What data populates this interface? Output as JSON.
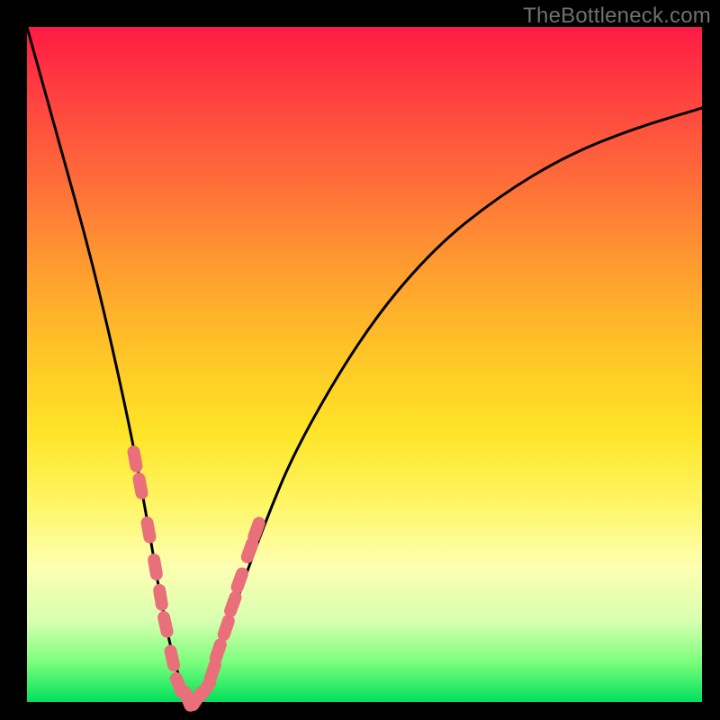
{
  "watermark": "TheBottleneck.com",
  "colors": {
    "gradient_top": "#ff1a44",
    "gradient_bottom": "#00e05a",
    "curve": "#000000",
    "markers": "#e96f7b",
    "frame": "#000000"
  },
  "chart_data": {
    "type": "line",
    "title": "",
    "xlabel": "",
    "ylabel": "",
    "xlim": [
      0,
      100
    ],
    "ylim": [
      0,
      100
    ],
    "series": [
      {
        "name": "bottleneck-curve",
        "description": "V-shaped bottleneck percentage curve",
        "x": [
          0,
          5,
          10,
          15,
          18,
          20,
          22,
          24,
          25,
          27,
          30,
          35,
          40,
          50,
          60,
          70,
          80,
          90,
          100
        ],
        "y": [
          100,
          82,
          64,
          42,
          26,
          14,
          5,
          0,
          0,
          3,
          12,
          26,
          38,
          55,
          67,
          75,
          81,
          85,
          88
        ]
      }
    ],
    "markers": {
      "name": "highlighted-points",
      "description": "Salmon pill-shaped markers clustered on both arms of the V near the minimum",
      "points_xy": [
        [
          16.0,
          36.0
        ],
        [
          16.8,
          32.0
        ],
        [
          18.0,
          25.5
        ],
        [
          19.0,
          20.0
        ],
        [
          19.8,
          15.5
        ],
        [
          20.5,
          11.5
        ],
        [
          21.5,
          6.5
        ],
        [
          22.5,
          2.5
        ],
        [
          23.8,
          0.5
        ],
        [
          25.2,
          0.5
        ],
        [
          26.5,
          2.0
        ],
        [
          27.5,
          4.5
        ],
        [
          28.3,
          7.5
        ],
        [
          29.5,
          11.0
        ],
        [
          30.5,
          14.5
        ],
        [
          31.5,
          18.0
        ],
        [
          33.0,
          22.5
        ],
        [
          34.0,
          25.5
        ]
      ]
    }
  }
}
